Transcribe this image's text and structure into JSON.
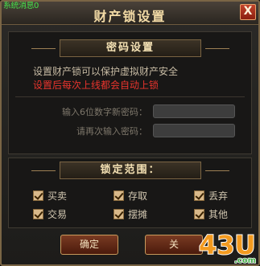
{
  "window": {
    "title": "财产锁设置",
    "corner_tag": "系统消息0",
    "close_label": "X"
  },
  "password_section": {
    "heading": "密码设置",
    "info_line1": "设置财产锁可以保护虚拟财产安全",
    "info_line2": "设置后每次上线都会自动上锁",
    "new_password_label": "输入6位数字新密码：",
    "confirm_password_label": "请再次输入密码：",
    "new_password_value": "",
    "confirm_password_value": ""
  },
  "lock_section": {
    "heading": "锁定范围：",
    "options": [
      {
        "label": "买卖",
        "checked": true
      },
      {
        "label": "存取",
        "checked": true
      },
      {
        "label": "丢弃",
        "checked": true
      },
      {
        "label": "交易",
        "checked": true
      },
      {
        "label": "摆摊",
        "checked": true
      },
      {
        "label": "其他",
        "checked": true
      }
    ]
  },
  "buttons": {
    "confirm": "确定",
    "cancel": "关"
  },
  "watermark": {
    "text": "43U",
    "suffix": ".com",
    "colors": {
      "orange": "#f39a1f",
      "yellow": "#ffd23a",
      "green": "#48b04a"
    }
  }
}
